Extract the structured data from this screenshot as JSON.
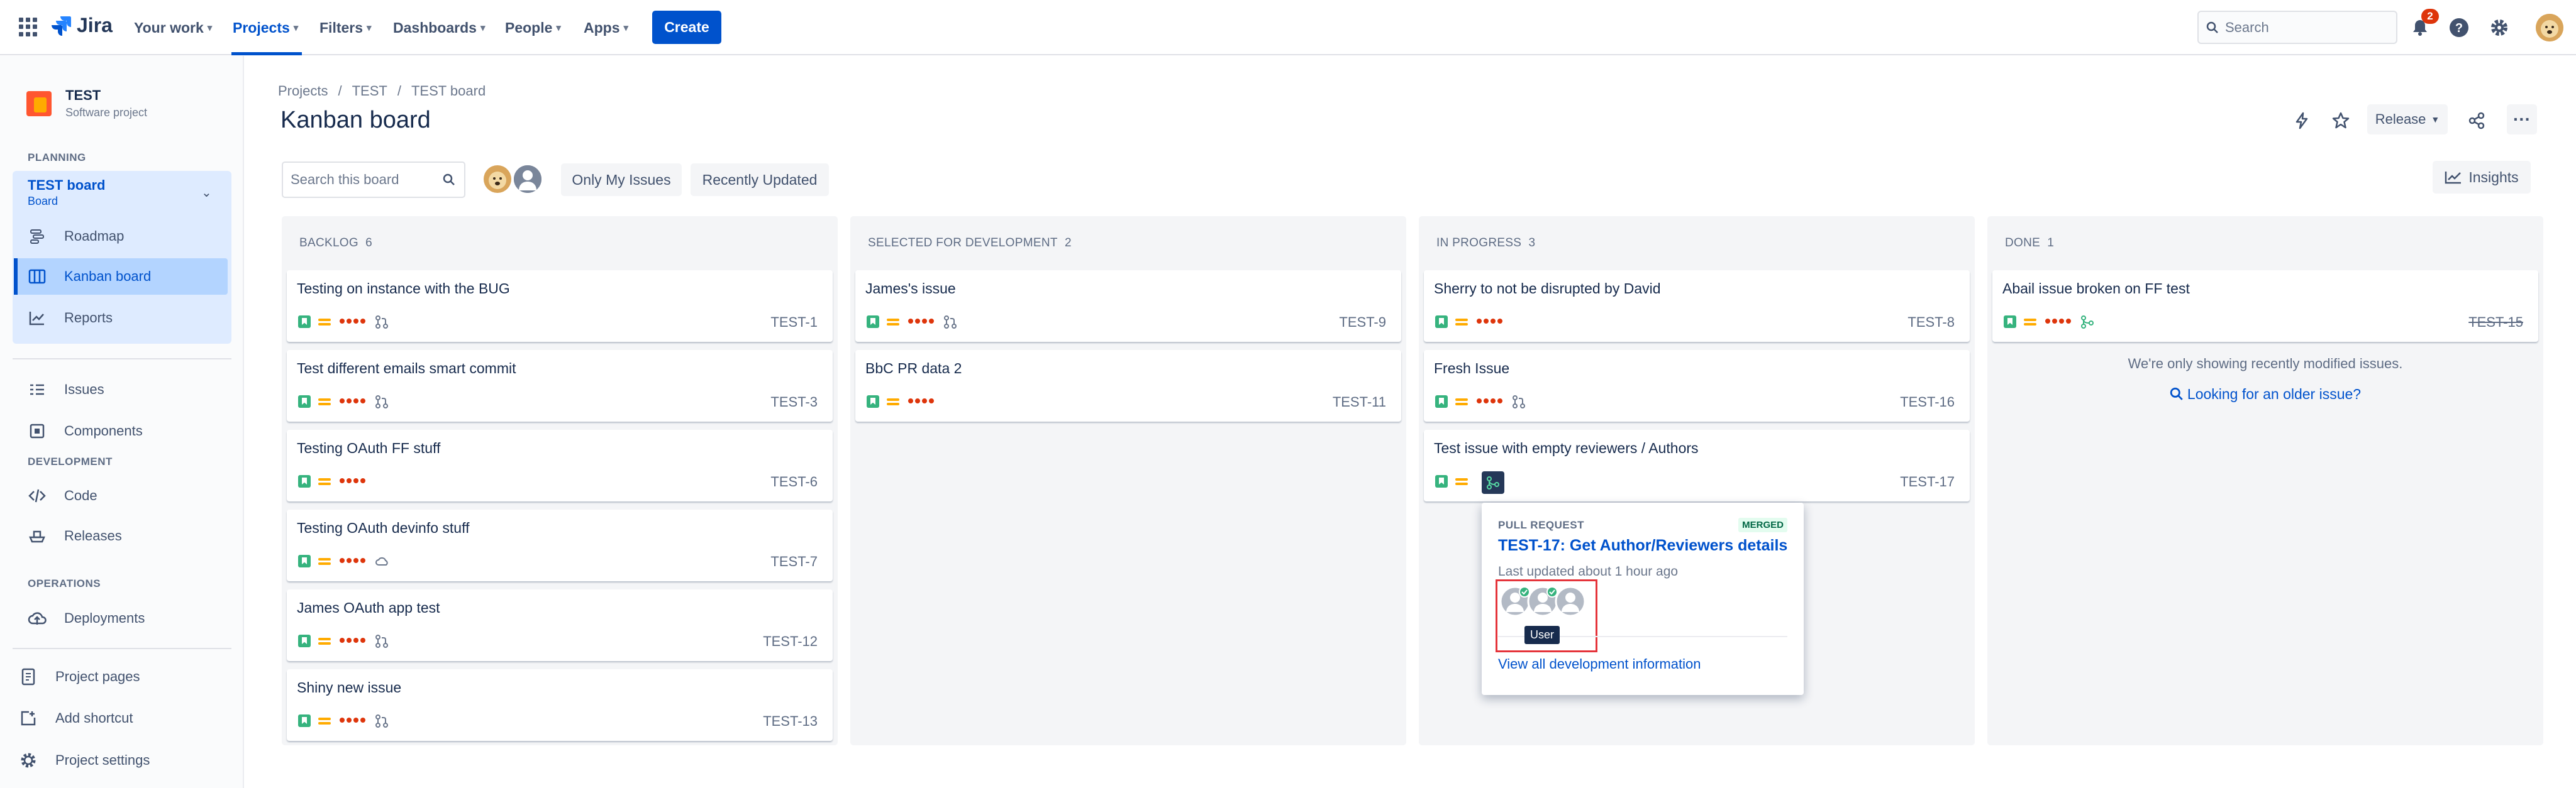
{
  "topnav": {
    "logo_text": "Jira",
    "items": [
      {
        "label": "Your work"
      },
      {
        "label": "Projects"
      },
      {
        "label": "Filters"
      },
      {
        "label": "Dashboards"
      },
      {
        "label": "People"
      },
      {
        "label": "Apps"
      }
    ],
    "create_label": "Create",
    "search_placeholder": "Search",
    "notification_count": "2"
  },
  "sidebar": {
    "project_name": "TEST",
    "project_type": "Software project",
    "planning_title": "PLANNING",
    "board_name": "TEST board",
    "board_sub": "Board",
    "planning_items": [
      {
        "label": "Roadmap"
      },
      {
        "label": "Kanban board"
      },
      {
        "label": "Reports"
      }
    ],
    "issues_label": "Issues",
    "components_label": "Components",
    "development_title": "DEVELOPMENT",
    "code_label": "Code",
    "releases_label": "Releases",
    "operations_title": "OPERATIONS",
    "deployments_label": "Deployments",
    "project_pages_label": "Project pages",
    "add_shortcut_label": "Add shortcut",
    "project_settings_label": "Project settings"
  },
  "main": {
    "breadcrumb": [
      "Projects",
      "TEST",
      "TEST board"
    ],
    "breadcrumb_sep": "/",
    "title": "Kanban board",
    "release_label": "Release",
    "search_placeholder": "Search this board",
    "only_my_issues": "Only My Issues",
    "recently_updated": "Recently Updated",
    "insights_label": "Insights"
  },
  "columns": [
    {
      "title": "BACKLOG",
      "count": "6",
      "cards": [
        {
          "title": "Testing on instance with the BUG",
          "key": "TEST-1"
        },
        {
          "title": "Test different emails smart commit",
          "key": "TEST-3"
        },
        {
          "title": "Testing OAuth FF stuff",
          "key": "TEST-6"
        },
        {
          "title": "Testing OAuth devinfo stuff",
          "key": "TEST-7"
        },
        {
          "title": "James OAuth app test",
          "key": "TEST-12"
        },
        {
          "title": "Shiny new issue",
          "key": "TEST-13"
        }
      ]
    },
    {
      "title": "SELECTED FOR DEVELOPMENT",
      "count": "2",
      "cards": [
        {
          "title": "James's issue",
          "key": "TEST-9"
        },
        {
          "title": "BbC PR data 2",
          "key": "TEST-11"
        }
      ]
    },
    {
      "title": "IN PROGRESS",
      "count": "3",
      "cards": [
        {
          "title": "Sherry to not be disrupted by David",
          "key": "TEST-8"
        },
        {
          "title": "Fresh Issue",
          "key": "TEST-16"
        },
        {
          "title": "Test issue with empty reviewers / Authors",
          "key": "TEST-17"
        }
      ]
    },
    {
      "title": "DONE",
      "count": "1",
      "cards": [
        {
          "title": "Abail issue broken on FF test",
          "key": "TEST-15"
        }
      ],
      "empty_msg": "We're only showing recently modified issues.",
      "older_link": "Looking for an older issue?"
    }
  ],
  "popup": {
    "header": "PULL REQUEST",
    "status": "MERGED",
    "title": "TEST-17: Get Author/Reviewers details",
    "updated": "Last updated about 1 hour ago",
    "tooltip": "User",
    "link": "View all development information"
  },
  "colors": {
    "brand": "#0052CC",
    "story": "#36B37E",
    "priority_medium": "#FFAB00",
    "highlight": "#E5333A"
  }
}
